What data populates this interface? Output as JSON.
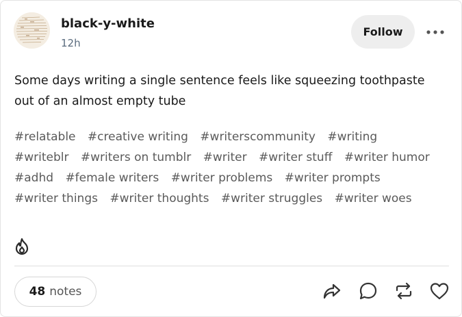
{
  "post": {
    "username": "black-y-white",
    "timestamp": "12h",
    "follow_label": "Follow",
    "body": "Some days writing a single sentence feels like squeezing toothpaste out of an almost empty tube",
    "tags": [
      [
        "#relatable",
        "#creative writing",
        "#writerscommunity",
        "#writing"
      ],
      [
        "#writeblr",
        "#writers on tumblr",
        "#writer",
        "#writer stuff",
        "#writer humor"
      ],
      [
        "#adhd",
        "#female writers",
        "#writer problems",
        "#writer prompts"
      ],
      [
        "#writer things",
        "#writer thoughts",
        "#writer struggles",
        "#writer woes"
      ]
    ]
  },
  "footer": {
    "notes_count": "48",
    "notes_label": "notes"
  },
  "icons": {
    "more": "ellipsis-icon",
    "flame": "flame-icon",
    "share": "share-icon",
    "reply": "reply-icon",
    "reblog": "reblog-icon",
    "like": "heart-icon"
  },
  "colors": {
    "text": "#1a1a1a",
    "muted": "#5a6b7d",
    "button_bg": "#eeeeee"
  }
}
